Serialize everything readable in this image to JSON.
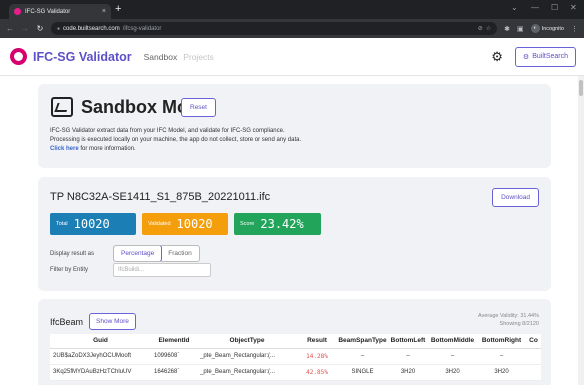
{
  "browser": {
    "tab_title": "IFC-SG Validator",
    "tab_close": "×",
    "new_tab": "+",
    "url_host": "code.builtsearch.com",
    "url_path": "/ifcsg-validator",
    "incognito_label": "Incognito",
    "window_min": "⌄",
    "window_restore": "—",
    "window_max": "☐",
    "window_close": "✕"
  },
  "header": {
    "brand": "IFC-SG Validator",
    "nav": [
      "Sandbox",
      "Projects"
    ],
    "builtsearch_label": "BuiltSearch"
  },
  "sandbox": {
    "title": "Sandbox Mode",
    "reset_label": "Reset",
    "desc_line1": "IFC-SG Validator extract data from your IFC Model, and validate for IFC-SG compliance.",
    "desc_line2": "Processing is executed locally on your machine, the app do not collect, store or send any data.",
    "click_here": "Click here",
    "desc_line3_rest": " for more information."
  },
  "file": {
    "name": "TP N8C32A-SE1411_S1_875B_20221011.ifc",
    "download_label": "Download",
    "stats": {
      "total_label": "Total",
      "total_value": "10020",
      "validated_label": "Validated",
      "validated_value": "10020",
      "score_label": "Score",
      "score_value": "23.42%"
    },
    "display_label": "Display result as",
    "display_options": [
      "Percentage",
      "Fraction"
    ],
    "display_selected": "Percentage",
    "filter_label": "Filter by Entity",
    "filter_placeholder": "IfcBuildi..."
  },
  "ifcbeam": {
    "title": "IfcBeam",
    "show_more_label": "Show More",
    "avg_validity": "Average Validity: 31.44%",
    "showing": "Showing 8/2120",
    "columns": [
      "Guid",
      "ElementId",
      "ObjectType",
      "Result",
      "BeamSpanType",
      "BottomLeft",
      "BottomMiddle",
      "BottomRight",
      "Co"
    ],
    "rows": [
      [
        "2UB$aZoDX3JeyhOCUMooft",
        "1099608`",
        "_pte_Beam_Rectangular:(...",
        "14.28%",
        "–",
        "–",
        "–",
        "–",
        ""
      ],
      [
        "3Kq25fMYDAuBzHzTChluUV",
        "1646268`",
        "_pte_Beam_Rectangular:(...",
        "42.85%",
        "SINGLE",
        "3H20",
        "3H20",
        "3H20",
        ""
      ]
    ]
  },
  "colors": {
    "brand": "#5e50c9",
    "total": "#1b7fb5",
    "validated": "#f59e0b",
    "score": "#22a55a",
    "result_text": "#d9534f"
  }
}
